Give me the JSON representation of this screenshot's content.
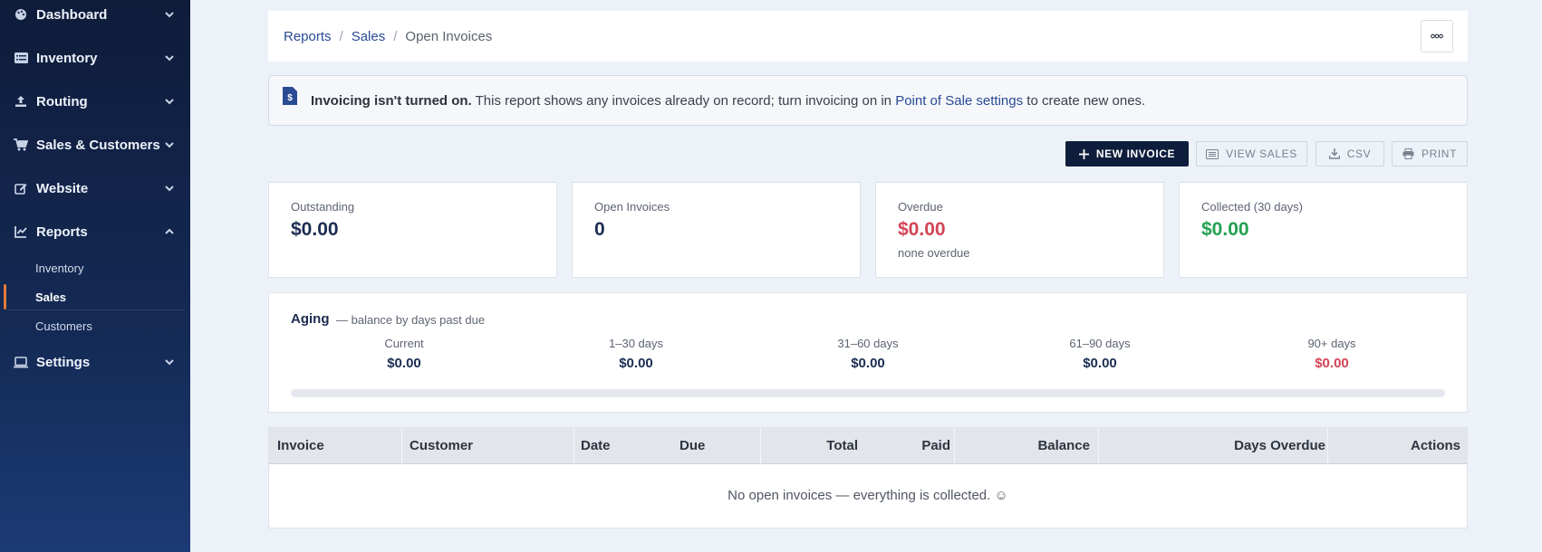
{
  "sidebar": {
    "items": [
      {
        "label": "Dashboard",
        "icon": "palette-icon"
      },
      {
        "label": "Inventory",
        "icon": "list-icon"
      },
      {
        "label": "Routing",
        "icon": "upload-icon"
      },
      {
        "label": "Sales & Customers",
        "icon": "cart-icon"
      },
      {
        "label": "Website",
        "icon": "edit-icon"
      },
      {
        "label": "Reports",
        "icon": "chart-icon"
      },
      {
        "label": "Settings",
        "icon": "laptop-icon"
      }
    ],
    "reports_sub": [
      {
        "label": "Inventory"
      },
      {
        "label": "Sales"
      },
      {
        "label": "Customers"
      }
    ]
  },
  "breadcrumb": {
    "items": [
      "Reports",
      "Sales",
      "Open Invoices"
    ],
    "more_icon": "ellipsis-icon"
  },
  "notice": {
    "bold": "Invoicing isn't turned on.",
    "text": " This report shows any invoices already on record; turn invoicing on in ",
    "link": "Point of Sale settings",
    "tail": " to create new ones."
  },
  "toolbar": {
    "new_invoice": "NEW INVOICE",
    "view_sales": "VIEW SALES",
    "csv": "CSV",
    "print": "PRINT"
  },
  "stats": [
    {
      "label": "Outstanding",
      "value": "$0.00",
      "sub": ""
    },
    {
      "label": "Open Invoices",
      "value": "0",
      "sub": ""
    },
    {
      "label": "Overdue",
      "value": "$0.00",
      "sub": "none overdue"
    },
    {
      "label": "Collected (30 days)",
      "value": "$0.00",
      "sub": ""
    }
  ],
  "aging": {
    "title": "Aging",
    "subtitle": "— balance by days past due",
    "buckets": [
      {
        "label": "Current",
        "value": "$0.00"
      },
      {
        "label": "1–30 days",
        "value": "$0.00"
      },
      {
        "label": "31–60 days",
        "value": "$0.00"
      },
      {
        "label": "61–90 days",
        "value": "$0.00"
      },
      {
        "label": "90+ days",
        "value": "$0.00"
      }
    ],
    "bar_fill": 0
  },
  "table": {
    "columns": [
      "Invoice",
      "Customer",
      "Date",
      "Due",
      "Total",
      "Paid",
      "Balance",
      "Days Overdue",
      "Actions"
    ],
    "empty_text": "No open invoices — everything is collected. ☺"
  },
  "colors": {
    "accent": "#0f1d3d",
    "link": "#2a4a94",
    "danger": "#d34456",
    "success": "#22a050",
    "active_marker": "#e27a3a"
  }
}
